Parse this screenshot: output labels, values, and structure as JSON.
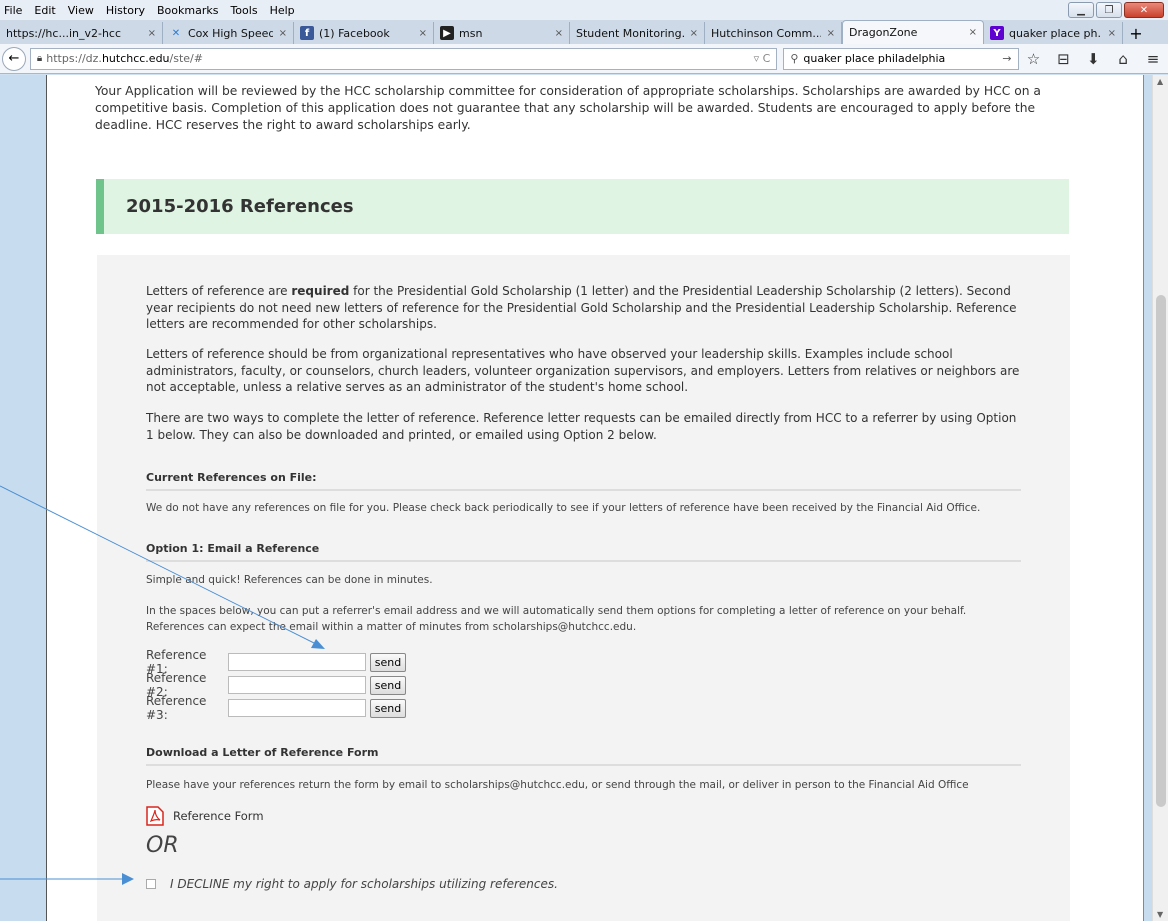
{
  "menu": [
    "File",
    "Edit",
    "View",
    "History",
    "Bookmarks",
    "Tools",
    "Help"
  ],
  "window_controls": {
    "minimize": "▁",
    "restore": "❐",
    "close": "✕"
  },
  "tabs": [
    {
      "title": "https://hc...in_v2-hcc",
      "icon": "page-icon",
      "active": false
    },
    {
      "title": "Cox High Speed...",
      "icon": "cox-icon",
      "active": false
    },
    {
      "title": "(1) Facebook",
      "icon": "facebook-icon",
      "active": false
    },
    {
      "title": "msn",
      "icon": "msn-icon",
      "active": false
    },
    {
      "title": "Student Monitoring...",
      "icon": "none",
      "active": false
    },
    {
      "title": "Hutchinson Comm...",
      "icon": "none",
      "active": false
    },
    {
      "title": "DragonZone",
      "icon": "none",
      "active": true
    },
    {
      "title": "quaker place ph...",
      "icon": "yahoo-icon",
      "active": false
    }
  ],
  "tab_close": "×",
  "new_tab": "+",
  "nav": {
    "back": "←",
    "url_prefix": "https://dz.",
    "url_domain": "hutchcc.edu",
    "url_path": "/ste/#",
    "url_extra": "▿ C",
    "search_value": "quaker place philadelphia",
    "search_go": "→"
  },
  "toolbar_icons": [
    "☆",
    "⊟",
    "⬇",
    "⌂",
    "≡"
  ],
  "intro_text": "Your Application will be reviewed by the HCC scholarship committee for consideration of appropriate scholarships. Scholarships are awarded by HCC on a competitive basis. Completion of this application does not guarantee that any scholarship will be awarded. Students are encouraged to apply before the deadline. HCC reserves the right to award scholarships early.",
  "section_title": "2015-2016 References",
  "para1_before": "Letters of reference are ",
  "para1_bold": "required",
  "para1_after": " for the Presidential Gold Scholarship (1 letter) and the Presidential Leadership Scholarship (2 letters). Second year recipients do not need new letters of reference for the Presidential Gold Scholarship and the Presidential Leadership Scholarship. Reference letters are recommended for other scholarships.",
  "para2": "Letters of reference should be from organizational representatives who have observed your leadership skills. Examples include school administrators, faculty, or counselors, church leaders, volunteer organization supervisors, and employers. Letters from relatives or neighbors are not acceptable, unless a relative serves as an administrator of the student's home school.",
  "para3": "There are two ways to complete the letter of reference. Reference letter requests can be emailed directly from HCC to a referrer by using Option 1 below. They can also be downloaded and printed, or emailed using Option 2 below.",
  "current_refs": {
    "heading": "Current References on File:",
    "text": "We do not have any references on file for you. Please check back periodically to see if your letters of reference have been received by the Financial Aid Office."
  },
  "option1": {
    "heading": "Option 1: Email a Reference",
    "line1": "Simple and quick! References can be done in minutes.",
    "line2": "In the spaces below, you can put a referrer's email address and we will automatically send them options for completing a letter of reference on your behalf. References can expect the email within a matter of minutes from scholarships@hutchcc.edu.",
    "refs": [
      {
        "label": "Reference #1:",
        "value": "",
        "button": "send"
      },
      {
        "label": "Reference #2:",
        "value": "",
        "button": "send"
      },
      {
        "label": "Reference #3:",
        "value": "",
        "button": "send"
      }
    ]
  },
  "download": {
    "heading": "Download a Letter of Reference Form",
    "text": "Please have your references return the form by email to scholarships@hutchcc.edu, or send through the mail, or deliver in person to the Financial Aid Office",
    "link": "Reference Form"
  },
  "or_text": "OR",
  "decline": {
    "label": "I DECLINE my right to apply for scholarships utilizing references.",
    "checked": false
  },
  "colors": {
    "section_bg": "#dff4e2",
    "section_border": "#6ec48a",
    "arrow": "#4a8fd4",
    "pdf_red": "#d9261c"
  }
}
